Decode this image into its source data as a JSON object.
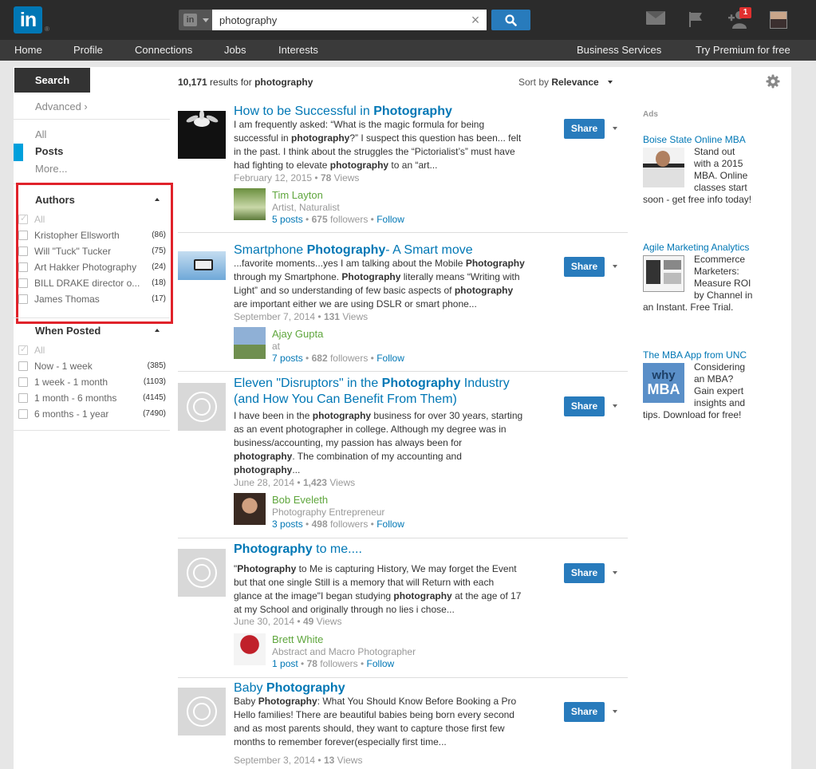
{
  "topbar": {
    "logo": "in",
    "logo_reg": "®",
    "search_type": "in",
    "search_value": "photography",
    "clear_icon": "×",
    "notifications_count": "1"
  },
  "nav": {
    "items": [
      "Home",
      "Profile",
      "Connections",
      "Jobs",
      "Interests"
    ],
    "right_items": [
      "Business Services",
      "Try Premium for free"
    ]
  },
  "left_rail": {
    "search_tab": "Search",
    "advanced": "Advanced ›",
    "scopes": [
      "All",
      "Posts",
      "More..."
    ],
    "authors": {
      "title": "Authors",
      "all": "All",
      "items": [
        {
          "name": "Kristopher Ellsworth",
          "count": "(86)"
        },
        {
          "name": "Will \"Tuck\" Tucker",
          "count": "(75)"
        },
        {
          "name": "Art Hakker Photography",
          "count": "(24)"
        },
        {
          "name": "BILL DRAKE director o...",
          "count": "(18)"
        },
        {
          "name": "James Thomas",
          "count": "(17)"
        }
      ]
    },
    "when_posted": {
      "title": "When Posted",
      "all": "All",
      "items": [
        {
          "name": "Now - 1 week",
          "count": "(385)"
        },
        {
          "name": "1 week - 1 month",
          "count": "(1103)"
        },
        {
          "name": "1 month - 6 months",
          "count": "(4145)"
        },
        {
          "name": "6 months - 1 year",
          "count": "(7490)"
        }
      ]
    }
  },
  "results_header": {
    "count": "10,171",
    "results_for": "results for",
    "query": "photography",
    "sort_by": "Sort by",
    "sort_value": "Relevance"
  },
  "results": [
    {
      "title_pre": "How to be Successful in ",
      "title_bold": "Photography",
      "title_post": "",
      "snippet_lines": [
        [
          [
            "I am frequently asked: “What is the magic formula for being",
            0
          ]
        ],
        [
          [
            "successful in ",
            0
          ],
          [
            "photography",
            1
          ],
          [
            "?” I suspect this question has been... felt",
            0
          ]
        ],
        [
          [
            "in the past. I think about the struggles the “Pictorialist’s” must have",
            0
          ]
        ],
        [
          [
            "had fighting to elevate ",
            0
          ],
          [
            "photography",
            1
          ],
          [
            " to an “art...",
            0
          ]
        ]
      ],
      "date": "February 12, 2015",
      "views": "78",
      "views_label": "Views",
      "author": "Tim Layton",
      "headline": "Artist, Naturalist",
      "posts": "5",
      "posts_label": "posts",
      "followers": "675",
      "followers_label": "followers",
      "follow": "Follow",
      "share": "Share"
    },
    {
      "title_pre": "Smartphone ",
      "title_bold": "Photography",
      "title_post": "- A Smart move",
      "snippet_lines": [
        [
          [
            "...favorite moments...yes I am talking about the Mobile ",
            0
          ],
          [
            "Photography",
            1
          ]
        ],
        [
          [
            "through my Smartphone. ",
            0
          ],
          [
            "Photography",
            1
          ],
          [
            " literally means “Writing with",
            0
          ]
        ],
        [
          [
            "Light” and so understanding of few basic aspects of ",
            0
          ],
          [
            "photography",
            1
          ]
        ],
        [
          [
            "are important either we are using DSLR or smart phone...",
            0
          ]
        ]
      ],
      "date": "September 7, 2014",
      "views": "131",
      "views_label": "Views",
      "author": "Ajay Gupta",
      "headline": "at",
      "posts": "7",
      "posts_label": "posts",
      "followers": "682",
      "followers_label": "followers",
      "follow": "Follow",
      "share": "Share"
    },
    {
      "title_pre": "Eleven \"Disruptors\" in the ",
      "title_bold": "Photography",
      "title_post": " Industry",
      "title_line2": "(and How You Can Benefit From Them)",
      "snippet_lines": [
        [
          [
            "I have been in the ",
            0
          ],
          [
            "photography",
            1
          ],
          [
            " business for over 30 years, starting",
            0
          ]
        ],
        [
          [
            "as an event photographer in college. Although my degree was in",
            0
          ]
        ],
        [
          [
            "business/accounting, my passion has always been for",
            0
          ]
        ],
        [
          [
            "photography",
            1
          ],
          [
            ". The combination of my accounting and",
            0
          ]
        ],
        [
          [
            "photography",
            1
          ],
          [
            "...",
            0
          ]
        ]
      ],
      "date": "June 28, 2014",
      "views": "1,423",
      "views_label": "Views",
      "author": "Bob Eveleth",
      "headline": "Photography Entrepreneur",
      "posts": "3",
      "posts_label": "posts",
      "followers": "498",
      "followers_label": "followers",
      "follow": "Follow",
      "share": "Share"
    },
    {
      "title_pre": "",
      "title_bold": "Photography",
      "title_post": " to me....",
      "snippet_lines": [
        [
          [
            "\"",
            0
          ],
          [
            "Photography",
            1
          ],
          [
            " to Me is capturing History, We may forget the Event",
            0
          ]
        ],
        [
          [
            "but that one single Still is a memory that will Return with each",
            0
          ]
        ],
        [
          [
            "glance at the image\"I began studying ",
            0
          ],
          [
            "photography",
            1
          ],
          [
            " at the age of 17",
            0
          ]
        ],
        [
          [
            "at my School and originally through no lies i chose...",
            0
          ]
        ]
      ],
      "date": "June 30, 2014",
      "views": "49",
      "views_label": "Views",
      "author": "Brett White",
      "headline": "Abstract and Macro Photographer",
      "posts": "1",
      "posts_label": "post",
      "followers": "78",
      "followers_label": "followers",
      "follow": "Follow",
      "share": "Share"
    },
    {
      "title_pre": "Baby ",
      "title_bold": "Photography",
      "title_post": "",
      "snippet_lines": [
        [
          [
            "Baby ",
            0
          ],
          [
            "Photography",
            1
          ],
          [
            ": What You Should Know Before Booking a Pro",
            0
          ]
        ],
        [
          [
            "Hello families! There are beautiful babies being born every second",
            0
          ]
        ],
        [
          [
            "and as most parents should, they want to capture those first few",
            0
          ]
        ],
        [
          [
            "months to remember forever(especially first time...",
            0
          ]
        ]
      ],
      "date": "September 3, 2014",
      "views": "13",
      "views_label": "Views",
      "share": "Share"
    }
  ],
  "ads": {
    "label": "Ads",
    "items": [
      {
        "title": "Boise State Online MBA",
        "text": "Stand out with a 2015 MBA. Online classes start soon - get free info today!"
      },
      {
        "title": "Agile Marketing Analytics",
        "text": "Ecommerce Marketers: Measure ROI by Channel in an Instant. Free Trial."
      },
      {
        "title": "The MBA App from UNC",
        "text": "Considering an MBA? Gain expert insights and tips. Download for free!",
        "img_text_1": "why",
        "img_text_2": "MBA"
      }
    ]
  },
  "colors": {
    "brand": "#0077b5",
    "topbar": "#2b2b2b",
    "navbar": "#3a3a3a",
    "share_button": "#287bbc",
    "author_name": "#5fa63d",
    "highlight_box": "#e0222a",
    "scope_active": "#00a0dc"
  },
  "icons": {
    "search": "search-icon",
    "messages": "envelope-icon",
    "notifications": "flag-icon",
    "add_connections": "add-person-icon",
    "settings": "gear-icon"
  }
}
